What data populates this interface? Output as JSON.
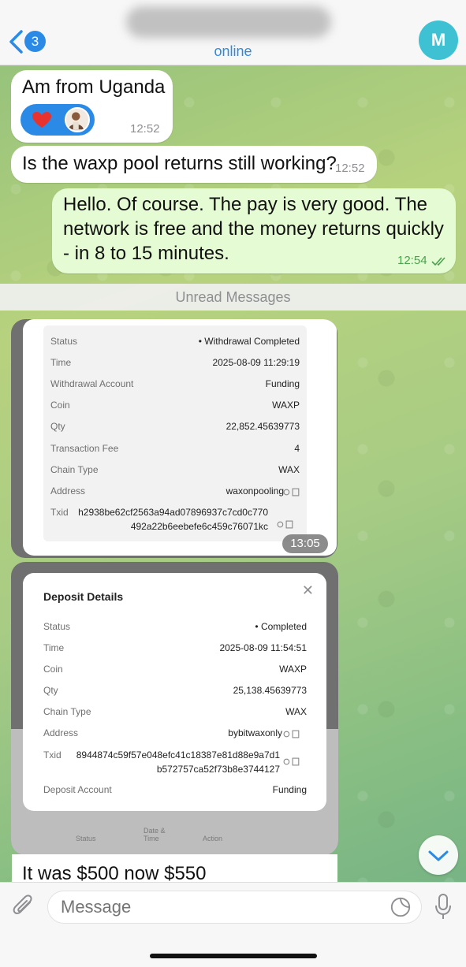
{
  "header": {
    "unread_count": "3",
    "status": "online",
    "avatar_letter": "M"
  },
  "messages": [
    {
      "text": "Am from Uganda",
      "time": "12:52"
    },
    {
      "text": "Is the waxp pool returns still working?",
      "time": "12:52"
    },
    {
      "text": "Hello. Of course. The pay is very good. The network is free and the money returns quickly - in 8 to 15 minutes.",
      "time": "12:54"
    }
  ],
  "unread_label": "Unread Messages",
  "withdrawal": {
    "time": "13:05",
    "rows": [
      {
        "label": "Status",
        "value": "• Withdrawal Completed"
      },
      {
        "label": "Time",
        "value": "2025-08-09 11:29:19"
      },
      {
        "label": "Withdrawal Account",
        "value": "Funding"
      },
      {
        "label": "Coin",
        "value": "WAXP"
      },
      {
        "label": "Qty",
        "value": "22,852.45639773"
      },
      {
        "label": "Transaction Fee",
        "value": "4"
      },
      {
        "label": "Chain Type",
        "value": "WAX"
      },
      {
        "label": "Address",
        "value": "waxonpooling"
      }
    ],
    "txid_label": "Txid",
    "txid_line1": "h2938be62cf2563a94ad07896937c7cd0c770",
    "txid_line2": "492a22b6eebefe6c459c76071kc"
  },
  "deposit": {
    "title": "Deposit Details",
    "rows": [
      {
        "label": "Status",
        "value": "• Completed"
      },
      {
        "label": "Time",
        "value": "2025-08-09 11:54:51"
      },
      {
        "label": "Coin",
        "value": "WAXP"
      },
      {
        "label": "Qty",
        "value": "25,138.45639773"
      },
      {
        "label": "Chain Type",
        "value": "WAX"
      },
      {
        "label": "Address",
        "value": "bybitwaxonly"
      }
    ],
    "txid_label": "Txid",
    "txid_line1": "8944874c59f57e048efc41c18387e81d88e9a7d1",
    "txid_line2": "b572757ca52f73b8e3744127",
    "account_label": "Deposit Account",
    "account_value": "Funding",
    "table_headers": [
      "Status",
      "Date & Time",
      "Action"
    ]
  },
  "caption": "It was $500 now $550",
  "input": {
    "placeholder": "Message"
  }
}
